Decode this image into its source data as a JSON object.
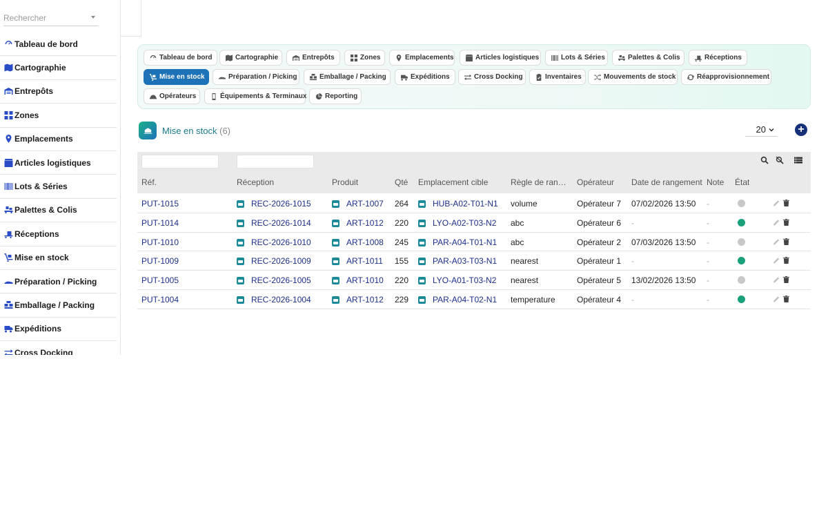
{
  "sidebar": {
    "search_placeholder": "Rechercher",
    "items": [
      {
        "label": "Tableau de bord",
        "icon": "gauge-icon"
      },
      {
        "label": "Cartographie",
        "icon": "map-icon"
      },
      {
        "label": "Entrepôts",
        "icon": "warehouse-icon"
      },
      {
        "label": "Zones",
        "icon": "grid-icon"
      },
      {
        "label": "Emplacements",
        "icon": "location-pin-icon"
      },
      {
        "label": "Articles logistiques",
        "icon": "box-icon"
      },
      {
        "label": "Lots & Séries",
        "icon": "barcode-icon"
      },
      {
        "label": "Palettes & Colis",
        "icon": "pallet-icon"
      },
      {
        "label": "Réceptions",
        "icon": "truck-loading-icon"
      },
      {
        "label": "Mise en stock",
        "icon": "dolly-icon"
      },
      {
        "label": "Préparation / Picking",
        "icon": "hand-picking-icon"
      },
      {
        "label": "Emballage / Packing",
        "icon": "boxes-packing-icon"
      },
      {
        "label": "Expéditions",
        "icon": "truck-icon"
      },
      {
        "label": "Cross Docking",
        "icon": "arrows-exchange-icon"
      }
    ]
  },
  "tabs": [
    {
      "label": "Tableau de bord",
      "icon": "gauge-icon",
      "active": false
    },
    {
      "label": "Cartographie",
      "icon": "map-icon",
      "active": false
    },
    {
      "label": "Entrepôts",
      "icon": "warehouse-icon",
      "active": false
    },
    {
      "label": "Zones",
      "icon": "grid-icon",
      "active": false
    },
    {
      "label": "Emplacements",
      "icon": "location-pin-icon",
      "active": false
    },
    {
      "label": "Articles logistiques",
      "icon": "box-icon",
      "active": false
    },
    {
      "label": "Lots & Séries",
      "icon": "barcode-icon",
      "active": false
    },
    {
      "label": "Palettes & Colis",
      "icon": "pallet-icon",
      "active": false
    },
    {
      "label": "Réceptions",
      "icon": "truck-loading-icon",
      "active": false
    },
    {
      "label": "Mise en stock",
      "icon": "dolly-icon",
      "active": true
    },
    {
      "label": "Préparation / Picking",
      "icon": "hand-picking-icon",
      "active": false
    },
    {
      "label": "Emballage / Packing",
      "icon": "boxes-packing-icon",
      "active": false
    },
    {
      "label": "Expéditions",
      "icon": "truck-icon",
      "active": false
    },
    {
      "label": "Cross Docking",
      "icon": "arrows-exchange-icon",
      "active": false
    },
    {
      "label": "Inventaires",
      "icon": "clipboard-check-icon",
      "active": false
    },
    {
      "label": "Mouvements de stock",
      "icon": "shuffle-icon",
      "active": false
    },
    {
      "label": "Réapprovisionnement",
      "icon": "refresh-icon",
      "active": false
    },
    {
      "label": "Opérateurs",
      "icon": "hard-hat-icon",
      "active": false
    },
    {
      "label": "Équipements & Terminaux",
      "icon": "mobile-icon",
      "active": false
    },
    {
      "label": "Reporting",
      "icon": "pie-chart-icon",
      "active": false
    }
  ],
  "section": {
    "title": "Mise en stock",
    "count": "(6)",
    "page_size": "20"
  },
  "table": {
    "columns": [
      "Réf.",
      "Réception",
      "Produit",
      "Qté",
      "Emplacement cible",
      "Règle de rangement",
      "Opérateur",
      "Date de rangement",
      "Note",
      "État"
    ],
    "rows": [
      {
        "ref": "PUT-1015",
        "reception": "REC-2026-1015",
        "produit": "ART-1007",
        "qte": "264",
        "emplacement": "HUB-A02-T01-N1",
        "regle": "volume",
        "operateur": "Opérateur 7",
        "date": "07/02/2026 13:50",
        "note": "-",
        "etat": "grey"
      },
      {
        "ref": "PUT-1014",
        "reception": "REC-2026-1014",
        "produit": "ART-1012",
        "qte": "220",
        "emplacement": "LYO-A02-T03-N2",
        "regle": "abc",
        "operateur": "Opérateur 6",
        "date": "-",
        "note": "-",
        "etat": "green"
      },
      {
        "ref": "PUT-1010",
        "reception": "REC-2026-1010",
        "produit": "ART-1008",
        "qte": "245",
        "emplacement": "PAR-A04-T01-N1",
        "regle": "abc",
        "operateur": "Opérateur 2",
        "date": "07/03/2026 13:50",
        "note": "-",
        "etat": "grey"
      },
      {
        "ref": "PUT-1009",
        "reception": "REC-2026-1009",
        "produit": "ART-1011",
        "qte": "155",
        "emplacement": "PAR-A03-T03-N1",
        "regle": "nearest",
        "operateur": "Opérateur 1",
        "date": "-",
        "note": "-",
        "etat": "green"
      },
      {
        "ref": "PUT-1005",
        "reception": "REC-2026-1005",
        "produit": "ART-1010",
        "qte": "220",
        "emplacement": "LYO-A01-T03-N2",
        "regle": "nearest",
        "operateur": "Opérateur 5",
        "date": "13/02/2026 13:50",
        "note": "-",
        "etat": "grey"
      },
      {
        "ref": "PUT-1004",
        "reception": "REC-2026-1004",
        "produit": "ART-1012",
        "qte": "229",
        "emplacement": "PAR-A04-T02-N1",
        "regle": "temperature",
        "operateur": "Opérateur 4",
        "date": "-",
        "note": "-",
        "etat": "green"
      }
    ]
  },
  "colors": {
    "accent": "#1d72b8",
    "link": "#1c2f8a",
    "status_green": "#1aa179",
    "status_grey": "#c8c8c8",
    "sidebar_icon": "#2a4cc7"
  }
}
